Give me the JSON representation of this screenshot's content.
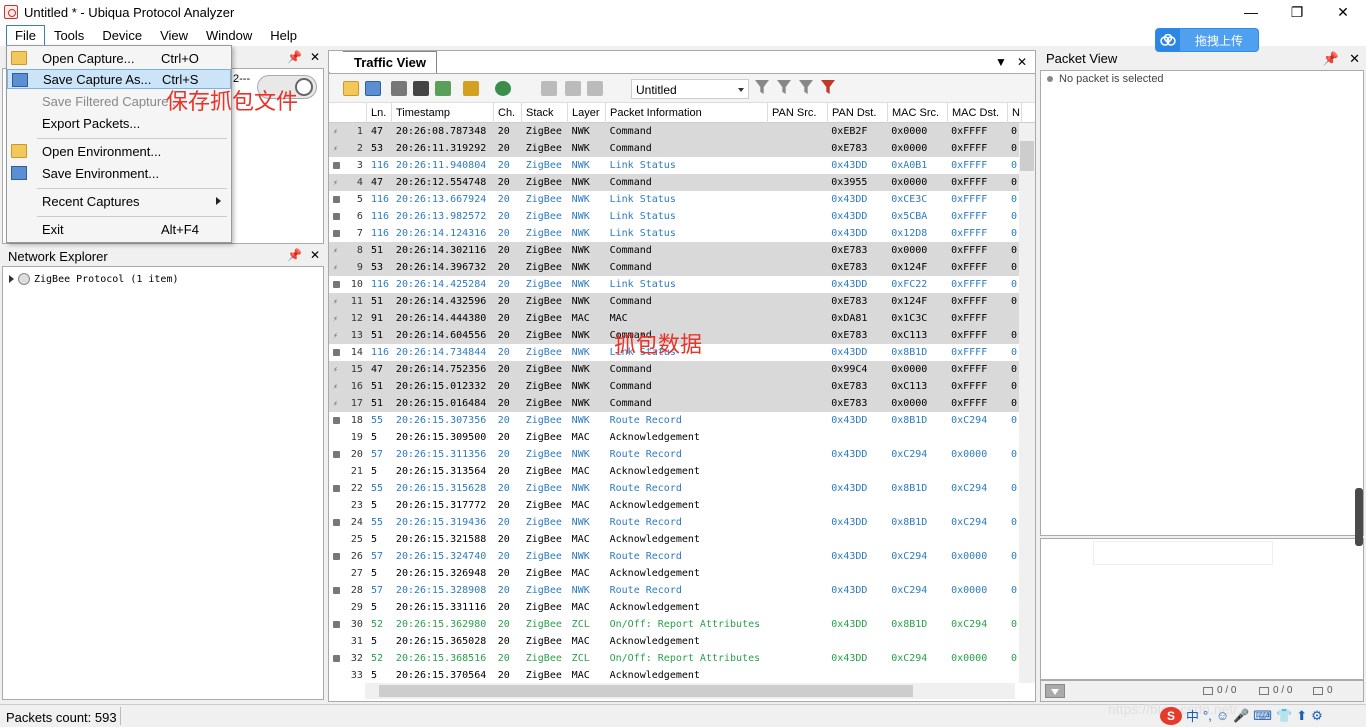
{
  "window": {
    "title": "Untitled * - Ubiqua Protocol Analyzer",
    "min": "—",
    "max": "❐",
    "close": "✕"
  },
  "menubar": {
    "items": [
      "File",
      "Tools",
      "Device",
      "View",
      "Window",
      "Help"
    ]
  },
  "upload": {
    "label": "拖拽上传"
  },
  "file_menu": [
    {
      "label": "Open Capture...",
      "shortcut": "Ctrl+O",
      "icon": "open-folder-icon",
      "state": "normal"
    },
    {
      "label": "Save Capture As...",
      "shortcut": "Ctrl+S",
      "icon": "save-capture-icon",
      "state": "highlighted"
    },
    {
      "label": "Save Filtered Capture...",
      "shortcut": "",
      "icon": "",
      "state": "disabled"
    },
    {
      "label": "Export Packets...",
      "shortcut": "",
      "icon": "",
      "state": "normal"
    },
    {
      "label": "Open Environment...",
      "shortcut": "",
      "icon": "open-folder-icon",
      "state": "normal"
    },
    {
      "label": "Save Environment...",
      "shortcut": "",
      "icon": "save-env-icon",
      "state": "normal"
    },
    {
      "label": "Recent Captures",
      "shortcut": "",
      "icon": "",
      "state": "submenu"
    },
    {
      "label": "Exit",
      "shortcut": "Alt+F4",
      "icon": "",
      "state": "normal"
    }
  ],
  "annotations": {
    "save": "保存抓包文件",
    "data": "抓包数据"
  },
  "left_top_partial": "2---",
  "network_explorer": {
    "title": "Network Explorer",
    "tree_item": "ZigBee Protocol (1 item)"
  },
  "traffic_view": {
    "tab": "Traffic View",
    "capture_select": "Untitled"
  },
  "columns": [
    "Ln.",
    "Timestamp",
    "Ch.",
    "Stack",
    "Layer",
    "Packet Information",
    "PAN Src.",
    "PAN Dst.",
    "MAC Src.",
    "MAC Dst.",
    "N"
  ],
  "packets": [
    {
      "n": "1",
      "ln": "47",
      "ts": "20:26:08.787348",
      "ch": "20",
      "stack": "ZigBee",
      "layer": "NWK",
      "info": "Command",
      "pan_src": "",
      "pan_dst": "0xEB2F",
      "mac_src": "0x0000",
      "mac_dst": "0xFFFF",
      "x": "0",
      "bg": "gray",
      "color": "black",
      "icon": "bolt"
    },
    {
      "n": "2",
      "ln": "53",
      "ts": "20:26:11.319292",
      "ch": "20",
      "stack": "ZigBee",
      "layer": "NWK",
      "info": "Command",
      "pan_src": "",
      "pan_dst": "0xE783",
      "mac_src": "0x0000",
      "mac_dst": "0xFFFF",
      "x": "0",
      "bg": "gray",
      "color": "black",
      "icon": "bolt"
    },
    {
      "n": "3",
      "ln": "116",
      "ts": "20:26:11.940804",
      "ch": "20",
      "stack": "ZigBee",
      "layer": "NWK",
      "info": "Link Status",
      "pan_src": "",
      "pan_dst": "0x43DD",
      "mac_src": "0xA0B1",
      "mac_dst": "0xFFFF",
      "x": "0",
      "bg": "white",
      "color": "blue",
      "icon": "lock"
    },
    {
      "n": "4",
      "ln": "47",
      "ts": "20:26:12.554748",
      "ch": "20",
      "stack": "ZigBee",
      "layer": "NWK",
      "info": "Command",
      "pan_src": "",
      "pan_dst": "0x3955",
      "mac_src": "0x0000",
      "mac_dst": "0xFFFF",
      "x": "0",
      "bg": "gray",
      "color": "black",
      "icon": "bolt"
    },
    {
      "n": "5",
      "ln": "116",
      "ts": "20:26:13.667924",
      "ch": "20",
      "stack": "ZigBee",
      "layer": "NWK",
      "info": "Link Status",
      "pan_src": "",
      "pan_dst": "0x43DD",
      "mac_src": "0xCE3C",
      "mac_dst": "0xFFFF",
      "x": "0",
      "bg": "white",
      "color": "blue",
      "icon": "lock"
    },
    {
      "n": "6",
      "ln": "116",
      "ts": "20:26:13.982572",
      "ch": "20",
      "stack": "ZigBee",
      "layer": "NWK",
      "info": "Link Status",
      "pan_src": "",
      "pan_dst": "0x43DD",
      "mac_src": "0x5CBA",
      "mac_dst": "0xFFFF",
      "x": "0",
      "bg": "white",
      "color": "blue",
      "icon": "lock"
    },
    {
      "n": "7",
      "ln": "116",
      "ts": "20:26:14.124316",
      "ch": "20",
      "stack": "ZigBee",
      "layer": "NWK",
      "info": "Link Status",
      "pan_src": "",
      "pan_dst": "0x43DD",
      "mac_src": "0x12D8",
      "mac_dst": "0xFFFF",
      "x": "0",
      "bg": "white",
      "color": "blue",
      "icon": "lock"
    },
    {
      "n": "8",
      "ln": "51",
      "ts": "20:26:14.302116",
      "ch": "20",
      "stack": "ZigBee",
      "layer": "NWK",
      "info": "Command",
      "pan_src": "",
      "pan_dst": "0xE783",
      "mac_src": "0x0000",
      "mac_dst": "0xFFFF",
      "x": "0",
      "bg": "gray",
      "color": "black",
      "icon": "bolt"
    },
    {
      "n": "9",
      "ln": "53",
      "ts": "20:26:14.396732",
      "ch": "20",
      "stack": "ZigBee",
      "layer": "NWK",
      "info": "Command",
      "pan_src": "",
      "pan_dst": "0xE783",
      "mac_src": "0x124F",
      "mac_dst": "0xFFFF",
      "x": "0",
      "bg": "gray",
      "color": "black",
      "icon": "bolt"
    },
    {
      "n": "10",
      "ln": "116",
      "ts": "20:26:14.425284",
      "ch": "20",
      "stack": "ZigBee",
      "layer": "NWK",
      "info": "Link Status",
      "pan_src": "",
      "pan_dst": "0x43DD",
      "mac_src": "0xFC22",
      "mac_dst": "0xFFFF",
      "x": "0",
      "bg": "white",
      "color": "blue",
      "icon": "lock"
    },
    {
      "n": "11",
      "ln": "51",
      "ts": "20:26:14.432596",
      "ch": "20",
      "stack": "ZigBee",
      "layer": "NWK",
      "info": "Command",
      "pan_src": "",
      "pan_dst": "0xE783",
      "mac_src": "0x124F",
      "mac_dst": "0xFFFF",
      "x": "0",
      "bg": "gray",
      "color": "black",
      "icon": "bolt"
    },
    {
      "n": "12",
      "ln": "91",
      "ts": "20:26:14.444380",
      "ch": "20",
      "stack": "ZigBee",
      "layer": "MAC",
      "info": "MAC",
      "pan_src": "",
      "pan_dst": "0xDA81",
      "mac_src": "0x1C3C",
      "mac_dst": "0xFFFF",
      "x": "",
      "bg": "gray",
      "color": "black",
      "icon": "bolt"
    },
    {
      "n": "13",
      "ln": "51",
      "ts": "20:26:14.604556",
      "ch": "20",
      "stack": "ZigBee",
      "layer": "NWK",
      "info": "Command",
      "pan_src": "",
      "pan_dst": "0xE783",
      "mac_src": "0xC113",
      "mac_dst": "0xFFFF",
      "x": "0",
      "bg": "gray",
      "color": "black",
      "icon": "bolt"
    },
    {
      "n": "14",
      "ln": "116",
      "ts": "20:26:14.734844",
      "ch": "20",
      "stack": "ZigBee",
      "layer": "NWK",
      "info": "Link Status",
      "pan_src": "",
      "pan_dst": "0x43DD",
      "mac_src": "0x8B1D",
      "mac_dst": "0xFFFF",
      "x": "0",
      "bg": "white",
      "color": "blue",
      "icon": "lock"
    },
    {
      "n": "15",
      "ln": "47",
      "ts": "20:26:14.752356",
      "ch": "20",
      "stack": "ZigBee",
      "layer": "NWK",
      "info": "Command",
      "pan_src": "",
      "pan_dst": "0x99C4",
      "mac_src": "0x0000",
      "mac_dst": "0xFFFF",
      "x": "0",
      "bg": "gray",
      "color": "black",
      "icon": "bolt"
    },
    {
      "n": "16",
      "ln": "51",
      "ts": "20:26:15.012332",
      "ch": "20",
      "stack": "ZigBee",
      "layer": "NWK",
      "info": "Command",
      "pan_src": "",
      "pan_dst": "0xE783",
      "mac_src": "0xC113",
      "mac_dst": "0xFFFF",
      "x": "0",
      "bg": "gray",
      "color": "black",
      "icon": "bolt"
    },
    {
      "n": "17",
      "ln": "51",
      "ts": "20:26:15.016484",
      "ch": "20",
      "stack": "ZigBee",
      "layer": "NWK",
      "info": "Command",
      "pan_src": "",
      "pan_dst": "0xE783",
      "mac_src": "0x0000",
      "mac_dst": "0xFFFF",
      "x": "0",
      "bg": "gray",
      "color": "black",
      "icon": "bolt"
    },
    {
      "n": "18",
      "ln": "55",
      "ts": "20:26:15.307356",
      "ch": "20",
      "stack": "ZigBee",
      "layer": "NWK",
      "info": "Route Record",
      "pan_src": "",
      "pan_dst": "0x43DD",
      "mac_src": "0x8B1D",
      "mac_dst": "0xC294",
      "x": "0",
      "bg": "white",
      "color": "blue",
      "icon": "lock"
    },
    {
      "n": "19",
      "ln": "5",
      "ts": "20:26:15.309500",
      "ch": "20",
      "stack": "ZigBee",
      "layer": "MAC",
      "info": "Acknowledgement",
      "pan_src": "",
      "pan_dst": "",
      "mac_src": "",
      "mac_dst": "",
      "x": "",
      "bg": "white",
      "color": "black",
      "icon": ""
    },
    {
      "n": "20",
      "ln": "57",
      "ts": "20:26:15.311356",
      "ch": "20",
      "stack": "ZigBee",
      "layer": "NWK",
      "info": "Route Record",
      "pan_src": "",
      "pan_dst": "0x43DD",
      "mac_src": "0xC294",
      "mac_dst": "0x0000",
      "x": "0",
      "bg": "white",
      "color": "blue",
      "icon": "lock"
    },
    {
      "n": "21",
      "ln": "5",
      "ts": "20:26:15.313564",
      "ch": "20",
      "stack": "ZigBee",
      "layer": "MAC",
      "info": "Acknowledgement",
      "pan_src": "",
      "pan_dst": "",
      "mac_src": "",
      "mac_dst": "",
      "x": "",
      "bg": "white",
      "color": "black",
      "icon": ""
    },
    {
      "n": "22",
      "ln": "55",
      "ts": "20:26:15.315628",
      "ch": "20",
      "stack": "ZigBee",
      "layer": "NWK",
      "info": "Route Record",
      "pan_src": "",
      "pan_dst": "0x43DD",
      "mac_src": "0x8B1D",
      "mac_dst": "0xC294",
      "x": "0",
      "bg": "white",
      "color": "blue",
      "icon": "lock"
    },
    {
      "n": "23",
      "ln": "5",
      "ts": "20:26:15.317772",
      "ch": "20",
      "stack": "ZigBee",
      "layer": "MAC",
      "info": "Acknowledgement",
      "pan_src": "",
      "pan_dst": "",
      "mac_src": "",
      "mac_dst": "",
      "x": "",
      "bg": "white",
      "color": "black",
      "icon": ""
    },
    {
      "n": "24",
      "ln": "55",
      "ts": "20:26:15.319436",
      "ch": "20",
      "stack": "ZigBee",
      "layer": "NWK",
      "info": "Route Record",
      "pan_src": "",
      "pan_dst": "0x43DD",
      "mac_src": "0x8B1D",
      "mac_dst": "0xC294",
      "x": "0",
      "bg": "white",
      "color": "blue",
      "icon": "lock"
    },
    {
      "n": "25",
      "ln": "5",
      "ts": "20:26:15.321588",
      "ch": "20",
      "stack": "ZigBee",
      "layer": "MAC",
      "info": "Acknowledgement",
      "pan_src": "",
      "pan_dst": "",
      "mac_src": "",
      "mac_dst": "",
      "x": "",
      "bg": "white",
      "color": "black",
      "icon": ""
    },
    {
      "n": "26",
      "ln": "57",
      "ts": "20:26:15.324740",
      "ch": "20",
      "stack": "ZigBee",
      "layer": "NWK",
      "info": "Route Record",
      "pan_src": "",
      "pan_dst": "0x43DD",
      "mac_src": "0xC294",
      "mac_dst": "0x0000",
      "x": "0",
      "bg": "white",
      "color": "blue",
      "icon": "lock"
    },
    {
      "n": "27",
      "ln": "5",
      "ts": "20:26:15.326948",
      "ch": "20",
      "stack": "ZigBee",
      "layer": "MAC",
      "info": "Acknowledgement",
      "pan_src": "",
      "pan_dst": "",
      "mac_src": "",
      "mac_dst": "",
      "x": "",
      "bg": "white",
      "color": "black",
      "icon": ""
    },
    {
      "n": "28",
      "ln": "57",
      "ts": "20:26:15.328908",
      "ch": "20",
      "stack": "ZigBee",
      "layer": "NWK",
      "info": "Route Record",
      "pan_src": "",
      "pan_dst": "0x43DD",
      "mac_src": "0xC294",
      "mac_dst": "0x0000",
      "x": "0",
      "bg": "white",
      "color": "blue",
      "icon": "lock"
    },
    {
      "n": "29",
      "ln": "5",
      "ts": "20:26:15.331116",
      "ch": "20",
      "stack": "ZigBee",
      "layer": "MAC",
      "info": "Acknowledgement",
      "pan_src": "",
      "pan_dst": "",
      "mac_src": "",
      "mac_dst": "",
      "x": "",
      "bg": "white",
      "color": "black",
      "icon": ""
    },
    {
      "n": "30",
      "ln": "52",
      "ts": "20:26:15.362980",
      "ch": "20",
      "stack": "ZigBee",
      "layer": "ZCL",
      "info": "On/Off: Report Attributes",
      "pan_src": "",
      "pan_dst": "0x43DD",
      "mac_src": "0x8B1D",
      "mac_dst": "0xC294",
      "x": "0",
      "bg": "white",
      "color": "green",
      "icon": "lock"
    },
    {
      "n": "31",
      "ln": "5",
      "ts": "20:26:15.365028",
      "ch": "20",
      "stack": "ZigBee",
      "layer": "MAC",
      "info": "Acknowledgement",
      "pan_src": "",
      "pan_dst": "",
      "mac_src": "",
      "mac_dst": "",
      "x": "",
      "bg": "white",
      "color": "black",
      "icon": ""
    },
    {
      "n": "32",
      "ln": "52",
      "ts": "20:26:15.368516",
      "ch": "20",
      "stack": "ZigBee",
      "layer": "ZCL",
      "info": "On/Off: Report Attributes",
      "pan_src": "",
      "pan_dst": "0x43DD",
      "mac_src": "0xC294",
      "mac_dst": "0x0000",
      "x": "0",
      "bg": "white",
      "color": "green",
      "icon": "lock"
    },
    {
      "n": "33",
      "ln": "5",
      "ts": "20:26:15.370564",
      "ch": "20",
      "stack": "ZigBee",
      "layer": "MAC",
      "info": "Acknowledgement",
      "pan_src": "",
      "pan_dst": "",
      "mac_src": "",
      "mac_dst": "",
      "x": "",
      "bg": "white",
      "color": "black",
      "icon": ""
    }
  ],
  "packet_view": {
    "title": "Packet View",
    "empty": "No packet is selected",
    "counts": [
      "0 / 0",
      "0 / 0",
      "0"
    ]
  },
  "status": {
    "packets": "Packets count: 593"
  },
  "tray": {
    "ime": "中",
    "items": [
      "°,",
      "☺",
      "🎤",
      "⌨",
      "👕",
      "⬆",
      "⚙"
    ]
  },
  "watermark": "https://blog.csdn.net/..."
}
